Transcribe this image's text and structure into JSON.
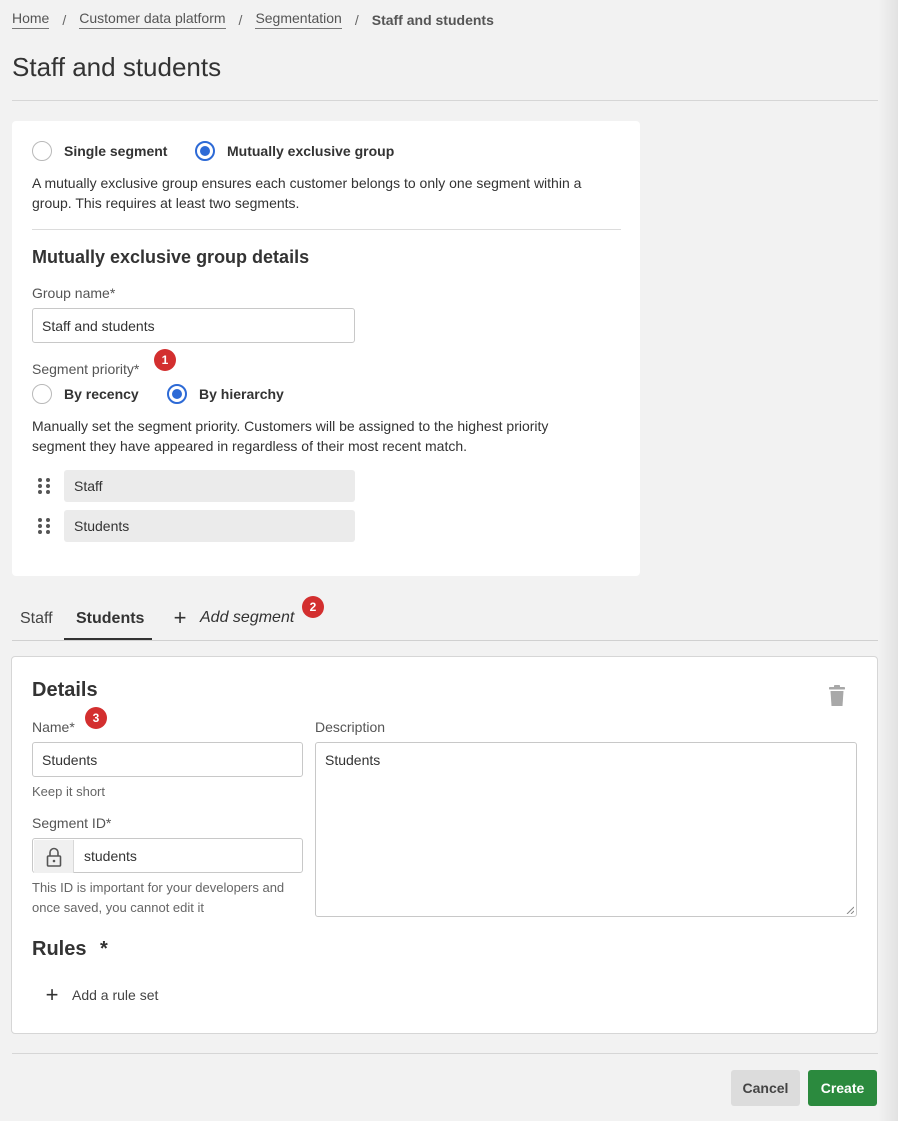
{
  "breadcrumb": {
    "items": [
      "Home",
      "Customer data platform",
      "Segmentation"
    ],
    "separator": "/",
    "current": "Staff and students"
  },
  "page_title": "Staff and students",
  "segment_type": {
    "options": [
      "Single segment",
      "Mutually exclusive group"
    ],
    "selected": "Mutually exclusive group",
    "help": "A mutually exclusive group ensures each customer belongs to only one segment within a group. This requires at least two segments."
  },
  "group_details": {
    "title": "Mutually exclusive group details",
    "group_name_label": "Group name*",
    "group_name_value": "Staff and students",
    "priority_label": "Segment priority*",
    "priority_options": [
      "By recency",
      "By hierarchy"
    ],
    "priority_selected": "By hierarchy",
    "priority_help": "Manually set the segment priority. Customers will be assigned to the highest priority segment they have appeared in regardless of their most recent match.",
    "priority_items": [
      "Staff",
      "Students"
    ]
  },
  "badges": [
    "1",
    "2",
    "3"
  ],
  "tabs": {
    "items": [
      "Staff",
      "Students"
    ],
    "active": "Students",
    "add_label": "Add segment"
  },
  "details": {
    "title": "Details",
    "name_label": "Name*",
    "name_value": "Students",
    "name_help": "Keep it short",
    "segment_id_label": "Segment ID*",
    "segment_id_value": "students",
    "segment_id_help": "This ID is important for your developers and once saved, you cannot edit it",
    "description_label": "Description",
    "description_value": "Students",
    "rules_title": "Rules",
    "rules_required": "*",
    "add_rule_label": "Add a rule set"
  },
  "footer": {
    "cancel_label": "Cancel",
    "create_label": "Create"
  },
  "colors": {
    "accent_blue": "#2d6ad6",
    "badge_red": "#d32f2f",
    "create_green": "#2b8a3e"
  },
  "icons": [
    "trash-icon",
    "lock-icon",
    "plus-icon",
    "drag-handle-icon"
  ]
}
